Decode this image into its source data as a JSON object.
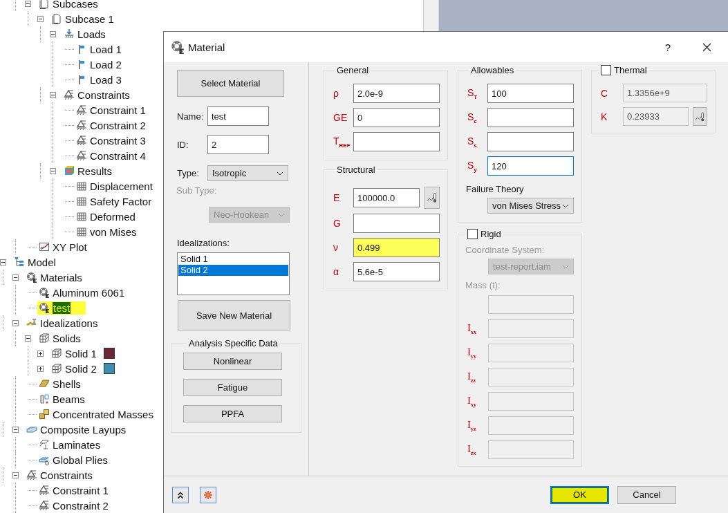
{
  "background_tree": {
    "cut_branch": [
      {
        "label": "Subcases",
        "kind": "page",
        "expanded": true,
        "selected": false,
        "children": [
          {
            "label": "Subcase 1",
            "kind": "page",
            "expanded": true,
            "selected": false,
            "children": [
              {
                "label": "Loads",
                "kind": "loads",
                "expanded": true,
                "selected": false,
                "children": [
                  {
                    "label": "Load 1",
                    "kind": "load",
                    "selected": false
                  },
                  {
                    "label": "Load 2",
                    "kind": "load",
                    "selected": false
                  },
                  {
                    "label": "Load 3",
                    "kind": "load",
                    "selected": false
                  }
                ]
              },
              {
                "label": "Constraints",
                "kind": "constraint",
                "expanded": true,
                "selected": false,
                "children": [
                  {
                    "label": "Constraint 1",
                    "kind": "constraint",
                    "selected": false
                  },
                  {
                    "label": "Constraint 2",
                    "kind": "constraint",
                    "selected": false
                  },
                  {
                    "label": "Constraint 3",
                    "kind": "constraint",
                    "selected": false
                  },
                  {
                    "label": "Constraint 4",
                    "kind": "constraint",
                    "selected": false
                  }
                ]
              },
              {
                "label": "Results",
                "kind": "results",
                "expanded": true,
                "selected": false,
                "children": [
                  {
                    "label": "Displacement",
                    "kind": "grid",
                    "selected": false
                  },
                  {
                    "label": "Safety Factor",
                    "kind": "grid",
                    "selected": false
                  },
                  {
                    "label": "Deformed",
                    "kind": "grid",
                    "selected": false
                  },
                  {
                    "label": "von Mises",
                    "kind": "grid",
                    "selected": false
                  }
                ]
              }
            ]
          }
        ]
      },
      {
        "label": "XY Plot",
        "kind": "plot",
        "selected": false
      }
    ],
    "items": [
      {
        "label": "Model",
        "kind": "model",
        "expanded": true,
        "selected": false,
        "children": [
          {
            "label": "Materials",
            "kind": "material",
            "expanded": true,
            "selected": false,
            "children": [
              {
                "label": "Aluminum 6061",
                "kind": "material",
                "selected": false
              },
              {
                "label": "test",
                "kind": "material",
                "selected": true
              }
            ]
          },
          {
            "label": "Idealizations",
            "kind": "idealization",
            "expanded": true,
            "selected": false,
            "children": [
              {
                "label": "Solids",
                "kind": "cube",
                "expanded": true,
                "selected": false,
                "children": [
                  {
                    "label": "Solid 1",
                    "kind": "cube",
                    "expanded": false,
                    "selected": false,
                    "color": "#6b2737"
                  },
                  {
                    "label": "Solid 2",
                    "kind": "cube",
                    "expanded": false,
                    "selected": false,
                    "color": "#3c8fb0"
                  }
                ]
              },
              {
                "label": "Shells",
                "kind": "shell",
                "selected": false
              },
              {
                "label": "Beams",
                "kind": "beam",
                "selected": false
              },
              {
                "label": "Concentrated Masses",
                "kind": "mass",
                "selected": false
              }
            ]
          },
          {
            "label": "Composite Layups",
            "kind": "layup",
            "expanded": true,
            "selected": false,
            "children": [
              {
                "label": "Laminates",
                "kind": "laminate",
                "selected": false
              },
              {
                "label": "Global Plies",
                "kind": "plies",
                "selected": false
              }
            ]
          },
          {
            "label": "Constraints",
            "kind": "constraint",
            "expanded": true,
            "selected": false,
            "children": [
              {
                "label": "Constraint 1",
                "kind": "constraint",
                "selected": false
              },
              {
                "label": "Constraint 2",
                "kind": "constraint",
                "selected": false
              }
            ]
          }
        ]
      }
    ]
  },
  "dialog": {
    "title": "Material",
    "help": "?",
    "left": {
      "select_button": "Select Material",
      "name": {
        "label": "Name:",
        "value": "test"
      },
      "id": {
        "label": "ID:",
        "value": "2"
      },
      "type": {
        "label": "Type:",
        "value": "Isotropic"
      },
      "sub_type": {
        "label": "Sub Type:",
        "value": "Neo-Hookean",
        "disabled": true
      },
      "idealizations": {
        "label": "Idealizations:",
        "items": [
          {
            "label": "Solid 1",
            "selected": false
          },
          {
            "label": "Solid 2",
            "selected": true
          }
        ]
      },
      "save_button": "Save New Material",
      "analysis": {
        "title": "Analysis Specific Data",
        "buttons": [
          "Nonlinear",
          "Fatigue",
          "PPFA"
        ]
      }
    },
    "general": {
      "title": "General",
      "fields": [
        {
          "symbol": "ρ",
          "value": "2.0e-9"
        },
        {
          "symbol": "GE",
          "value": "0"
        },
        {
          "symbol": "T$_{REF}$"
        }
      ]
    },
    "structural": {
      "title": "Structural",
      "fields": [
        {
          "symbol": "E",
          "value": "100000.0",
          "kind": "with_table",
          "highlighted": false
        },
        {
          "symbol": "G",
          "kind": "plain",
          "highlighted": false
        },
        {
          "symbol": "ν",
          "value": "0.499",
          "kind": "plain",
          "highlighted": true
        },
        {
          "symbol": "α",
          "value": "5.6e-5",
          "kind": "plain",
          "highlighted": false
        }
      ]
    },
    "allowables": {
      "title": "Allowables",
      "fields": [
        {
          "symbol": "S$_{T}$",
          "value": "100",
          "focused": false
        },
        {
          "symbol": "S$_{c}$",
          "focused": false
        },
        {
          "symbol": "S$_{s}$",
          "focused": false
        },
        {
          "symbol": "S$_{y}$",
          "value": "120",
          "focused": true
        }
      ],
      "failure_theory": {
        "label": "Failure Theory",
        "value": "von Mises Stress"
      }
    },
    "rigid": {
      "label": "Rigid",
      "checked": false,
      "coordinate_system": {
        "label": "Coordinate System:",
        "value": "test-report.iam"
      },
      "mass_label": "Mass (t):",
      "inertia": [
        {
          "symbol": "I$_{xx}$"
        },
        {
          "symbol": "I$_{yy}$"
        },
        {
          "symbol": "I$_{zz}$"
        },
        {
          "symbol": "I$_{xy}$"
        },
        {
          "symbol": "I$_{yz}$"
        },
        {
          "symbol": "I$_{zx}$"
        }
      ]
    },
    "thermal": {
      "label": "Thermal",
      "checked": false,
      "fields": [
        {
          "symbol": "C",
          "value": "1.3356e+9",
          "kind": "plain"
        },
        {
          "symbol": "K",
          "value": "0.23933",
          "kind": "with_table"
        }
      ]
    },
    "footer": {
      "buttons": [
        {
          "label": "OK",
          "default": true,
          "highlighted": true
        },
        {
          "label": "Cancel",
          "default": false,
          "highlighted": false
        }
      ]
    }
  }
}
